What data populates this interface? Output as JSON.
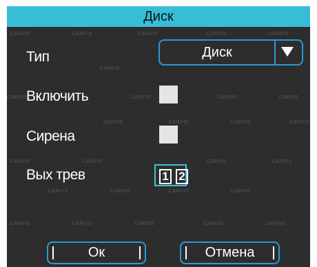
{
  "dialog": {
    "title": "Диск"
  },
  "rows": {
    "type_label": "Тип",
    "type_value": "Диск",
    "enable_label": "Включить",
    "siren_label": "Сирена",
    "alarm_out_label": "Вых трев"
  },
  "relays": [
    "1",
    "2"
  ],
  "buttons": {
    "ok": "Ок",
    "cancel": "Отмена"
  },
  "watermark": "CARVIS",
  "colors": {
    "title_bar": "#37bdd8",
    "panel": "#2d2d2d",
    "border_accent": "#2a9ad8",
    "focus": "#3ec7e0",
    "checkbox": "#e5e5e5"
  },
  "icons": {
    "select_arrow": "caret-down-icon"
  }
}
